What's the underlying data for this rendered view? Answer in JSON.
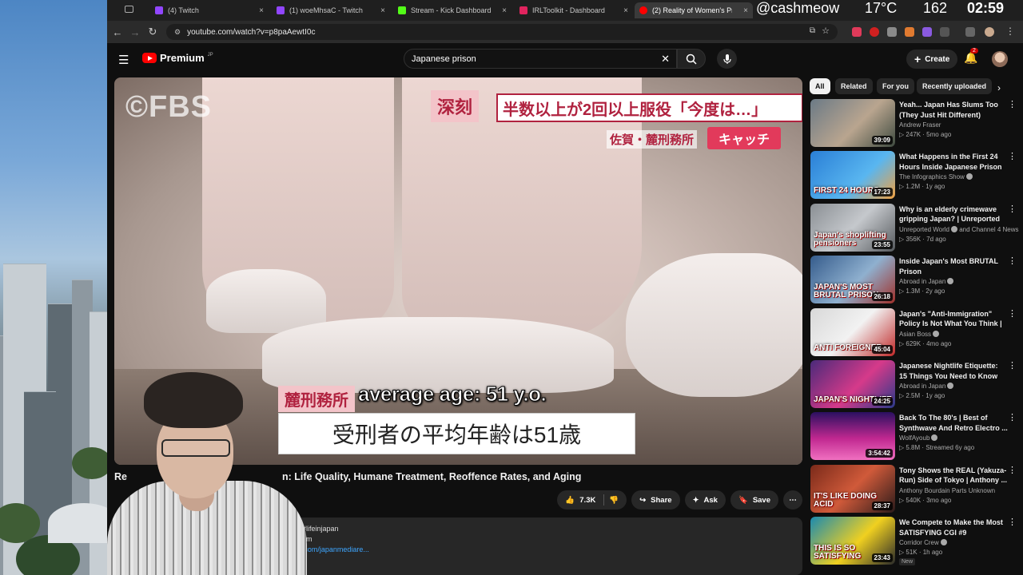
{
  "browser": {
    "tabs": [
      {
        "label": "(4) Twitch",
        "color": "#9146ff"
      },
      {
        "label": "(1) woeMhsaC - Twitch",
        "color": "#9146ff"
      },
      {
        "label": "Stream - Kick Dashboard",
        "color": "#53fc18"
      },
      {
        "label": "IRLToolkit - Dashboard",
        "color": "#e0245e"
      },
      {
        "label": "(2) Reality of Women's Pr",
        "color": "#ff0000"
      }
    ],
    "url": "youtube.com/watch?v=p8paAewtI0c"
  },
  "stream_overlay": {
    "handle": "@cashmeow",
    "temperature": "17°C",
    "count": "162",
    "time": "02:59"
  },
  "youtube": {
    "brand": "Premium",
    "brand_region": "JP",
    "search_query": "Japanese prison",
    "create_label": "Create",
    "notification_count": "2"
  },
  "video": {
    "watermark": "©FBS",
    "caption_tag": "深刻",
    "caption_headline": "半数以上が2回以上服役「今度は…」",
    "caption_location": "佐賀・麓刑務所",
    "caption_show": "キャッチ",
    "caption_prison": "麓刑務所",
    "caption_main": "受刑者の平均年齢は51歳",
    "subtitle": "average age: 51 y.o.",
    "title_start": "Re",
    "title_rest": "n: Life Quality, Humane Treatment, Reoffence Rates, and Aging",
    "likes": "7.3K",
    "share_label": "Share",
    "ask_label": "Ask",
    "save_label": "Save",
    "desc_line1": "lture #lifeinjapan",
    "desc_line2": "iew.com",
    "desc_line3": "offee.com/japanmediare...",
    "desc_more": "more"
  },
  "sidebar": {
    "chips": [
      "All",
      "Related",
      "For you",
      "Recently uploaded"
    ],
    "items": [
      {
        "title": "Yeah... Japan Has Slums Too (They Just Hit Different)",
        "channel": "Andrew Fraser",
        "verified": false,
        "meta": "▷ 247K · 5mo ago",
        "duration": "39:09",
        "thumb_text": "",
        "bg": "linear-gradient(135deg,#6b7a86,#b9a58f 55%,#3e4a3f)"
      },
      {
        "title": "What Happens in the First 24 Hours Inside Japanese Prison",
        "channel": "The Infographics Show",
        "verified": true,
        "meta": "▷ 1.2M · 1y ago",
        "duration": "17:23",
        "thumb_text": "FIRST 24 HOURS",
        "bg": "linear-gradient(135deg,#2a7fd6,#59b6f0 60%,#f0a040)"
      },
      {
        "title": "Why is an elderly crimewave gripping Japan? | Unreported ...",
        "channel": "Unreported World",
        "verified": true,
        "channel_extra": "and Channel 4 News",
        "meta": "▷ 356K · 7d ago",
        "duration": "23:55",
        "thumb_text": "Japan's shoplifting pensioners",
        "bg": "linear-gradient(135deg,#8a8f94,#c5c8cc 50%,#55595d)"
      },
      {
        "title": "Inside Japan's Most BRUTAL Prison",
        "channel": "Abroad in Japan",
        "verified": true,
        "meta": "▷ 1.3M · 2y ago",
        "duration": "26:18",
        "thumb_text": "JAPAN'S MOST BRUTAL PRISON",
        "bg": "linear-gradient(135deg,#355c8c,#8fb0cf 55%,#a0302a)"
      },
      {
        "title": "Japan's \"Anti-Immigration\" Policy Is Not What You Think | ...",
        "channel": "Asian Boss",
        "verified": true,
        "meta": "▷ 629K · 4mo ago",
        "duration": "45:04",
        "thumb_text": "ANTI FOREIGNER",
        "bg": "linear-gradient(135deg,#d8d8d8,#f2f2f2 50%,#c02828)"
      },
      {
        "title": "Japanese Nightlife Etiquette: 15 Things You Need to Know",
        "channel": "Abroad in Japan",
        "verified": true,
        "meta": "▷ 2.5M · 1y ago",
        "duration": "24:25",
        "thumb_text": "JAPAN'S NIGHTLIFE",
        "bg": "linear-gradient(135deg,#4a2a7a,#d63a8a 55%,#2a3a8a)"
      },
      {
        "title": "Back To The 80's | Best of Synthwave And Retro Electro ...",
        "channel": "WolfAyoub",
        "verified": true,
        "meta": "▷ 5.8M · Streamed 6y ago",
        "duration": "3:54:42",
        "thumb_text": "",
        "bg": "linear-gradient(180deg,#2a1060,#c02890 55%,#f070c0)"
      },
      {
        "title": "Tony Shows the REAL (Yakuza-Run) Side of Tokyo | Anthony ...",
        "channel": "Anthony Bourdain Parts Unknown",
        "verified": false,
        "meta": "▷ 540K · 3mo ago",
        "duration": "28:37",
        "thumb_text": "IT'S LIKE DOING ACID",
        "bg": "linear-gradient(135deg,#7a2a1a,#d05a3a 50%,#2a1a1a)"
      },
      {
        "title": "We Compete to Make the Most SATISFYING CGI #9",
        "channel": "Corridor Crew",
        "verified": true,
        "meta": "▷ 51K · 1h ago",
        "is_new": "New",
        "duration": "23:43",
        "thumb_text": "THIS IS SO SATISFYING",
        "bg": "linear-gradient(135deg,#1a8ab0,#f0d020 55%,#2a2a2a)"
      }
    ]
  }
}
